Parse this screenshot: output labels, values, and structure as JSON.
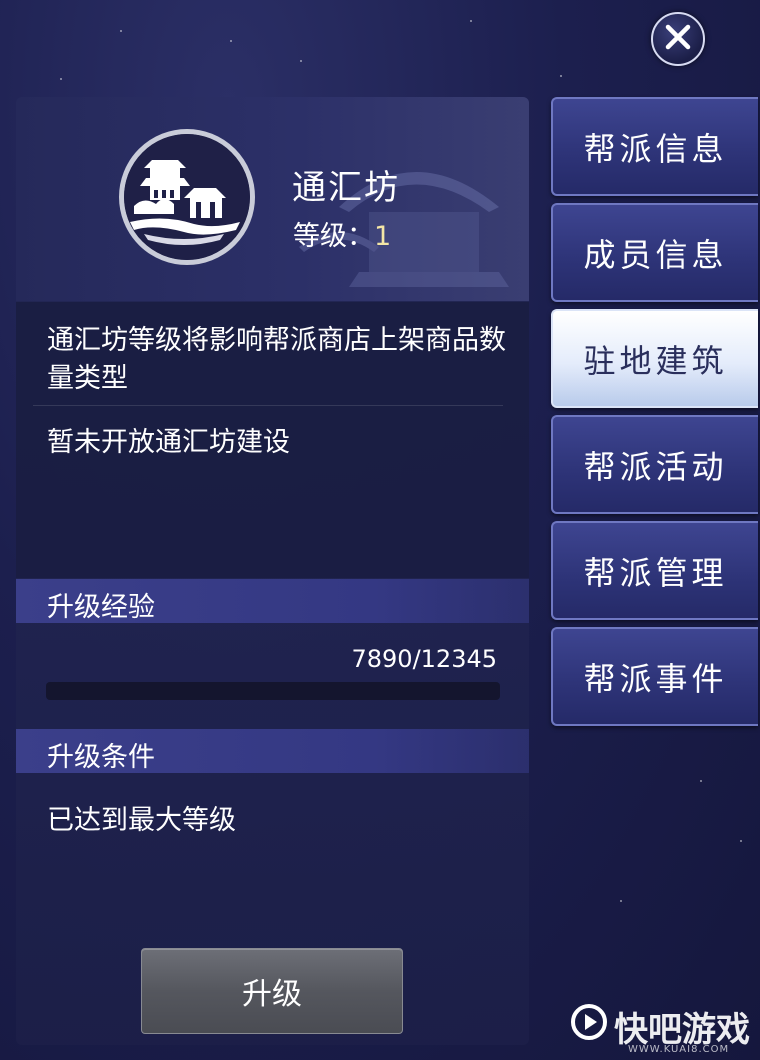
{
  "building": {
    "name": "通汇坊",
    "level_label": "等级",
    "level_sep": "：",
    "level_value": "1",
    "description": "通汇坊等级将影响帮派商店上架商品数量类型",
    "status": "暂未开放通汇坊建设"
  },
  "experience": {
    "section_title": "升级经验",
    "value_text": "7890/12345",
    "progress_fraction": 0.0
  },
  "conditions": {
    "section_title": "升级条件",
    "text": "已达到最大等级"
  },
  "upgrade_button": {
    "label": "升级"
  },
  "tabs": [
    {
      "label": "帮派信息",
      "active": false
    },
    {
      "label": "成员信息",
      "active": false
    },
    {
      "label": "驻地建筑",
      "active": true
    },
    {
      "label": "帮派活动",
      "active": false
    },
    {
      "label": "帮派管理",
      "active": false
    },
    {
      "label": "帮派事件",
      "active": false
    }
  ],
  "watermark": {
    "text": "快吧游戏",
    "url": "WWW.KUAI8.COM"
  },
  "icons": {
    "close": "close-icon",
    "emblem": "pavilion-emblem-icon",
    "watermark_logo": "play-logo-icon"
  },
  "colors": {
    "accent_level": "#f4e6a6",
    "tab_active": "#e4ecfb",
    "tab_inactive": "#2d3377"
  }
}
